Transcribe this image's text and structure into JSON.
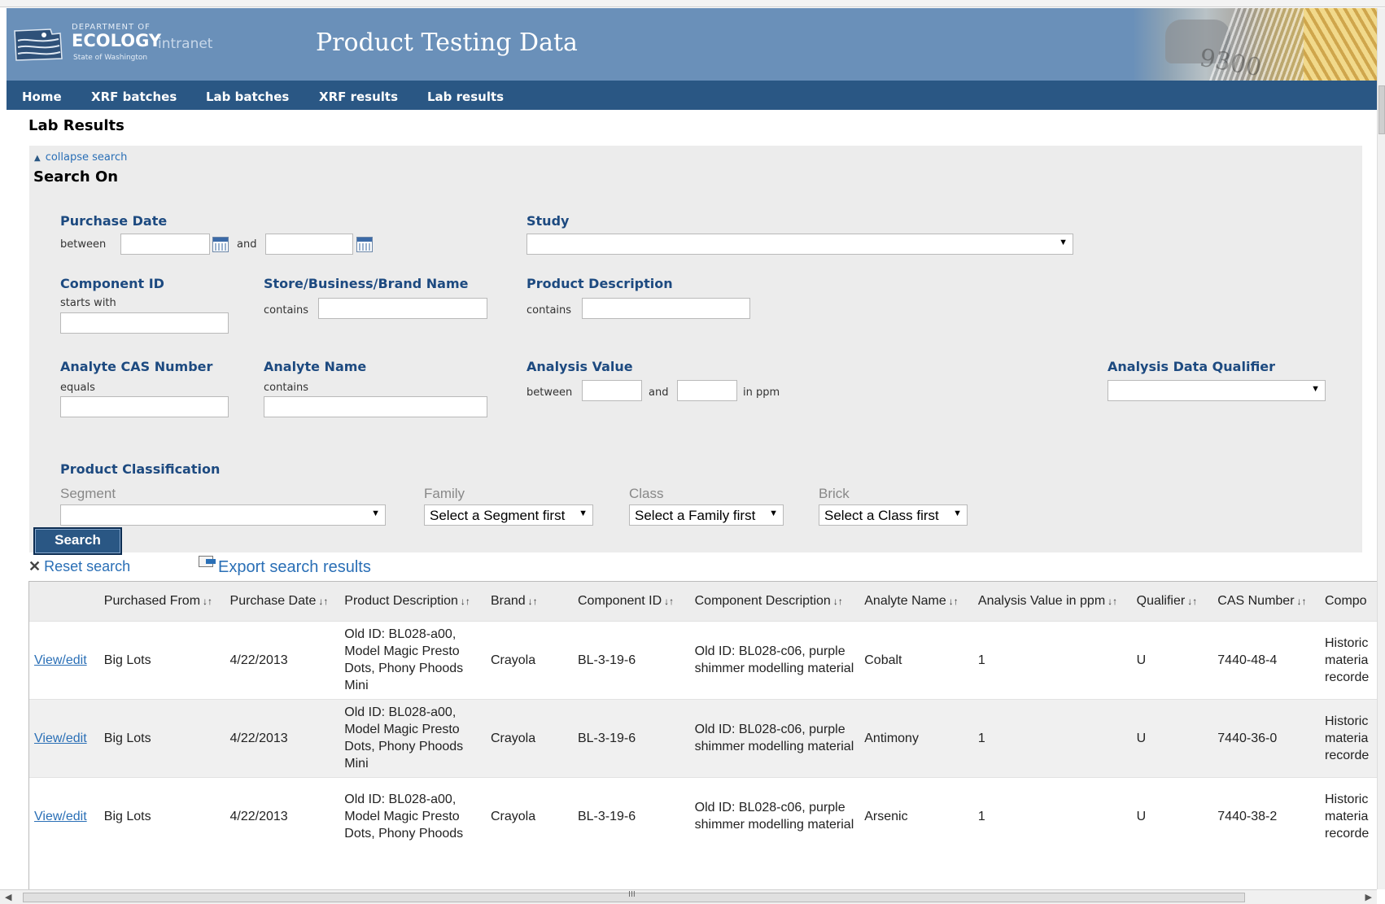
{
  "header": {
    "logo": {
      "dept": "DEPARTMENT OF",
      "name": "ECOLOGY",
      "suffix": "intranet",
      "state": "State of Washington"
    },
    "title": "Product Testing Data",
    "banner_number": "9300"
  },
  "nav": {
    "items": [
      "Home",
      "XRF batches",
      "Lab batches",
      "XRF results",
      "Lab results"
    ]
  },
  "page_title": "Lab Results",
  "search": {
    "collapse_label": "collapse search",
    "heading": "Search On",
    "purchase_date": {
      "label": "Purchase Date",
      "between": "between",
      "and": "and",
      "from": "",
      "to": ""
    },
    "study": {
      "label": "Study",
      "value": ""
    },
    "component_id": {
      "label": "Component ID",
      "sub": "starts with",
      "value": ""
    },
    "store": {
      "label": "Store/Business/Brand Name",
      "sub": "contains",
      "value": ""
    },
    "product_description": {
      "label": "Product Description",
      "sub": "contains",
      "value": ""
    },
    "analyte_cas": {
      "label": "Analyte CAS Number",
      "sub": "equals",
      "value": ""
    },
    "analyte_name": {
      "label": "Analyte Name",
      "sub": "contains",
      "value": ""
    },
    "analysis_value": {
      "label": "Analysis Value",
      "between": "between",
      "and": "and",
      "unit": "in ppm",
      "from": "",
      "to": ""
    },
    "qualifier": {
      "label": "Analysis Data Qualifier",
      "value": ""
    },
    "classification": {
      "label": "Product Classification",
      "segment": {
        "label": "Segment",
        "value": ""
      },
      "family": {
        "label": "Family",
        "value": "Select a Segment first"
      },
      "class": {
        "label": "Class",
        "value": "Select a Family first"
      },
      "brick": {
        "label": "Brick",
        "value": "Select a Class first"
      }
    },
    "button": "Search"
  },
  "actions": {
    "reset": "Reset search",
    "export": "Export search results"
  },
  "table": {
    "columns": [
      "",
      "Purchased From",
      "Purchase Date",
      "Product Description",
      "Brand",
      "Component ID",
      "Component Description",
      "Analyte Name",
      "Analysis Value in ppm",
      "Qualifier",
      "CAS Number",
      "Compo"
    ],
    "rows": [
      {
        "link": "View/edit",
        "from": "Big Lots",
        "date": "4/22/2013",
        "product": "Old ID: BL028-a00, Model Magic Presto Dots, Phony Phoods Mini",
        "brand": "Crayola",
        "component_id": "BL-3-19-6",
        "component_desc": "Old ID: BL028-c06, purple shimmer modelling material",
        "analyte": "Cobalt",
        "value": "1",
        "qualifier": "U",
        "cas": "7440-48-4",
        "comp": "Historic materia recorde"
      },
      {
        "link": "View/edit",
        "from": "Big Lots",
        "date": "4/22/2013",
        "product": "Old ID: BL028-a00, Model Magic Presto Dots, Phony Phoods Mini",
        "brand": "Crayola",
        "component_id": "BL-3-19-6",
        "component_desc": "Old ID: BL028-c06, purple shimmer modelling material",
        "analyte": "Antimony",
        "value": "1",
        "qualifier": "U",
        "cas": "7440-36-0",
        "comp": "Historic materia recorde"
      },
      {
        "link": "View/edit",
        "from": "Big Lots",
        "date": "4/22/2013",
        "product": "Old ID: BL028-a00, Model Magic Presto Dots, Phony Phoods",
        "brand": "Crayola",
        "component_id": "BL-3-19-6",
        "component_desc": "Old ID: BL028-c06, purple shimmer modelling material",
        "analyte": "Arsenic",
        "value": "1",
        "qualifier": "U",
        "cas": "7440-38-2",
        "comp": "Historic materia recorde"
      }
    ]
  },
  "scrollbar": {
    "grip": "III"
  }
}
